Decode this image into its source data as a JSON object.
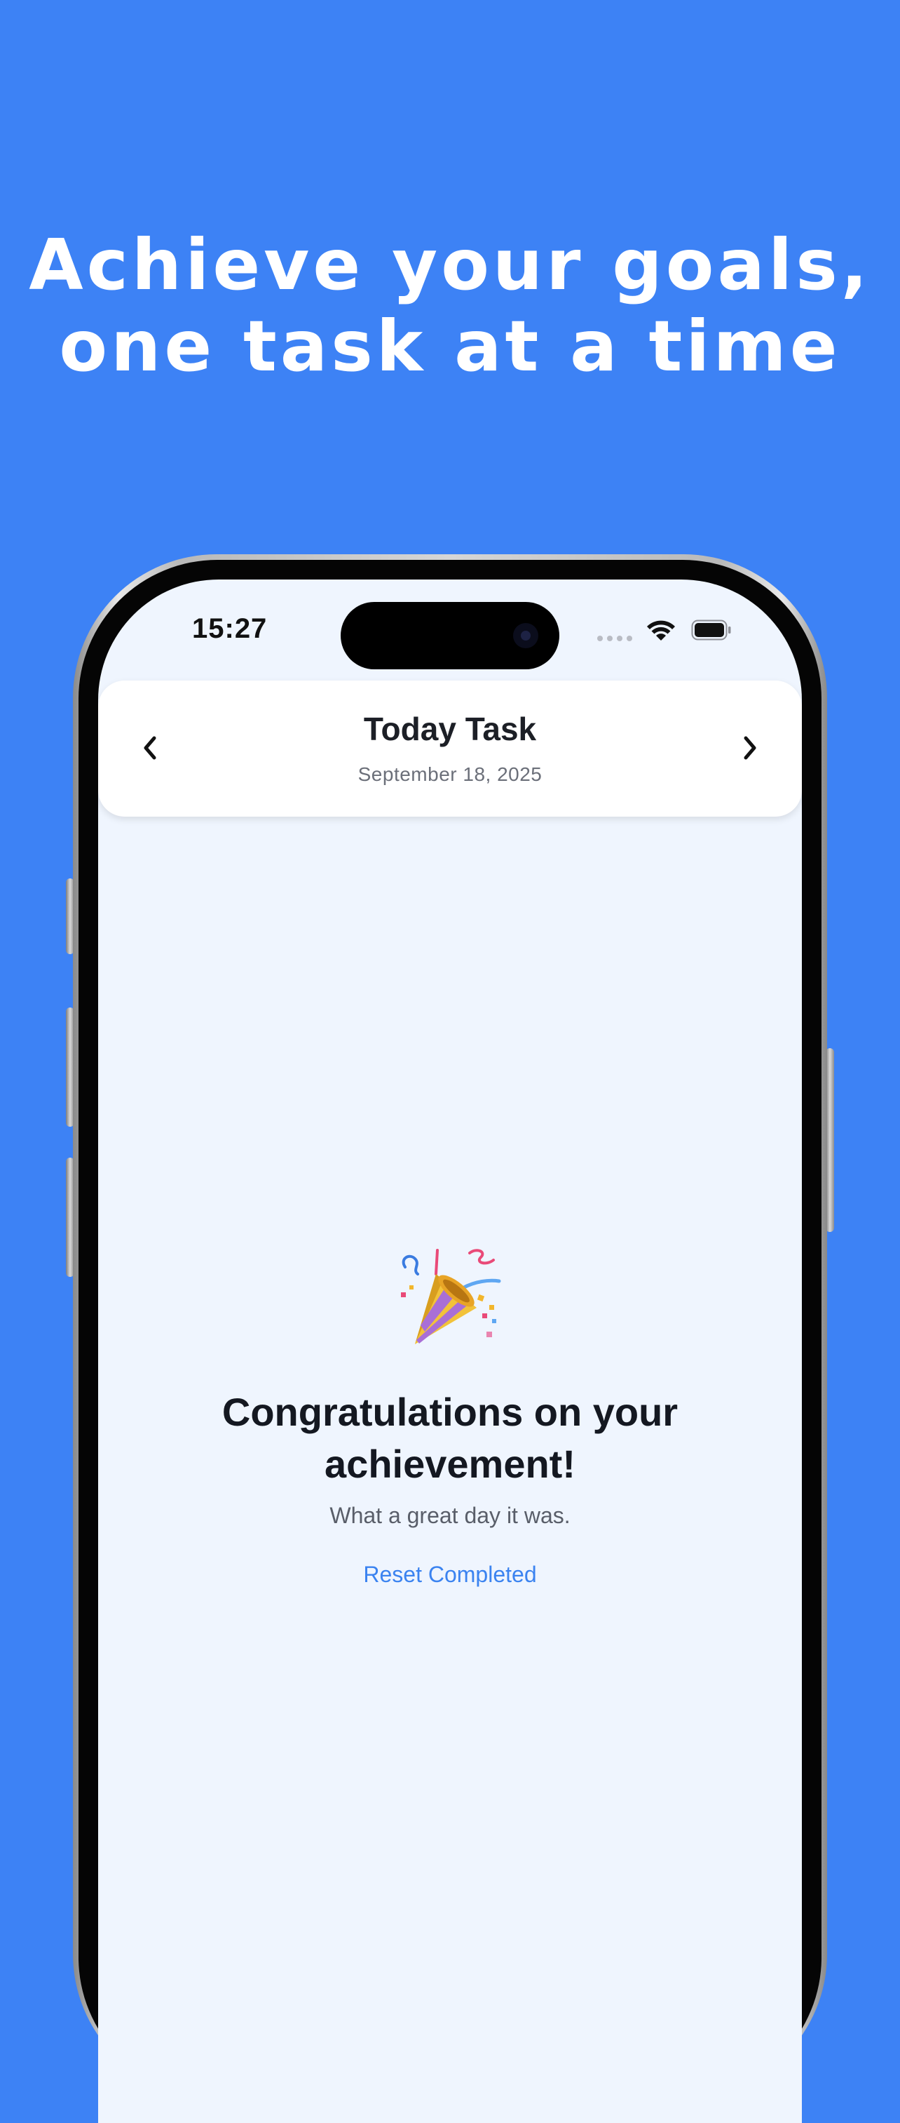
{
  "marketing": {
    "headline_line1": "Achieve your goals,",
    "headline_line2": "one task at a time"
  },
  "status_bar": {
    "time": "15:27",
    "icons": [
      "cellular-signal-icon",
      "wifi-icon",
      "battery-icon"
    ]
  },
  "header": {
    "title": "Today Task",
    "date": "September 18, 2025",
    "prev_icon": "chevron-left-icon",
    "next_icon": "chevron-right-icon"
  },
  "celebration": {
    "emoji": "party-popper-icon",
    "title": "Congratulations on your achievement!",
    "subtitle": "What a great day it was.",
    "reset_label": "Reset Completed"
  },
  "colors": {
    "background": "#3d82f5",
    "screen_background": "#eff5fe",
    "link": "#3b83f0",
    "title_text": "#141821"
  }
}
